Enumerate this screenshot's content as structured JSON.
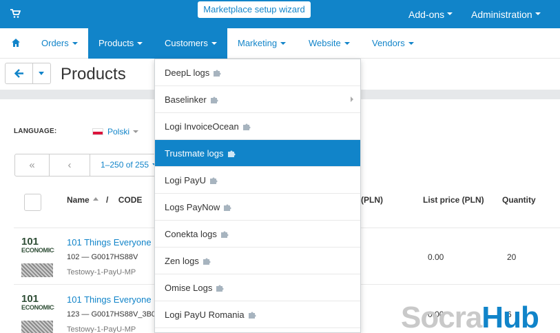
{
  "topbar": {
    "cart_icon": "shopping-cart-icon",
    "wizard_label": "Marketplace setup wizard",
    "addons_label": "Add-ons",
    "administration_label": "Administration"
  },
  "nav": {
    "home_icon": "home-icon",
    "items": [
      {
        "label": "Orders"
      },
      {
        "label": "Products"
      },
      {
        "label": "Customers"
      },
      {
        "label": "Marketing"
      },
      {
        "label": "Website"
      },
      {
        "label": "Vendors"
      }
    ]
  },
  "toolbar": {
    "back_icon": "arrow-left-icon",
    "page_title": "Products"
  },
  "language": {
    "label": "LANGUAGE:",
    "value": "Polski"
  },
  "pager": {
    "first": "«",
    "prev": "‹",
    "count": "1–250 of 255"
  },
  "table": {
    "headers": {
      "name": "Name",
      "separator": "/",
      "code": "CODE",
      "price": "(PLN)",
      "list_price": "List price (PLN)",
      "quantity": "Quantity"
    },
    "rows": [
      {
        "thumb_title": "101",
        "thumb_sub": "ECONOMICS",
        "name": "101 Things Everyone",
        "code": "102 — G0017HS88V",
        "vendor": "Testowy-1-PayU-MP",
        "list_price": "0.00",
        "quantity": "20"
      },
      {
        "thumb_title": "101",
        "thumb_sub": "ECONOMICS",
        "name": "101 Things Everyone",
        "code": "123 — G0017HS88V_3B0",
        "vendor": "Testowy-1-PayU-MP",
        "list_price": "0.00",
        "quantity": "6"
      }
    ]
  },
  "dropdown": {
    "items": [
      {
        "label": "DeepL logs",
        "icon": "puzzle-icon"
      },
      {
        "label": "Baselinker",
        "icon": "puzzle-icon",
        "has_submenu": true
      },
      {
        "label": "Logi InvoiceOcean",
        "icon": "puzzle-icon"
      },
      {
        "label": "Trustmate logs",
        "icon": "puzzle-icon",
        "active": true
      },
      {
        "label": "Logi PayU",
        "icon": "puzzle-icon"
      },
      {
        "label": "Logs PayNow",
        "icon": "puzzle-icon"
      },
      {
        "label": "Conekta logs",
        "icon": "puzzle-icon"
      },
      {
        "label": "Zen logs",
        "icon": "puzzle-icon"
      },
      {
        "label": "Omise Logs",
        "icon": "puzzle-icon"
      },
      {
        "label": "Logi PayU Romania",
        "icon": "puzzle-icon"
      }
    ]
  },
  "watermark": {
    "part1": "Socra",
    "part2": "Hub"
  },
  "colors": {
    "accent": "#1184c9",
    "band": "#e6e8ea"
  }
}
